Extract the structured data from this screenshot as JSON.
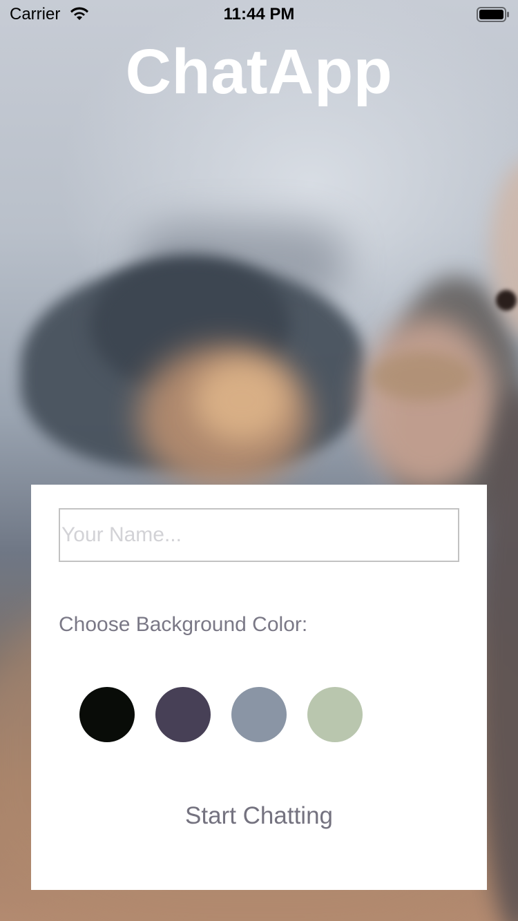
{
  "status_bar": {
    "carrier": "Carrier",
    "time": "11:44 PM",
    "wifi_icon": "wifi-icon",
    "battery_icon": "battery-icon"
  },
  "app": {
    "title": "ChatApp"
  },
  "form": {
    "name_placeholder": "Your Name...",
    "name_value": "",
    "color_label": "Choose Background Color:",
    "colors": [
      {
        "name": "black",
        "hex": "#090C08"
      },
      {
        "name": "purple",
        "hex": "#474056"
      },
      {
        "name": "grey-blue",
        "hex": "#8A95A5"
      },
      {
        "name": "sage-green",
        "hex": "#B9C6AE"
      }
    ],
    "start_label": "Start Chatting"
  }
}
